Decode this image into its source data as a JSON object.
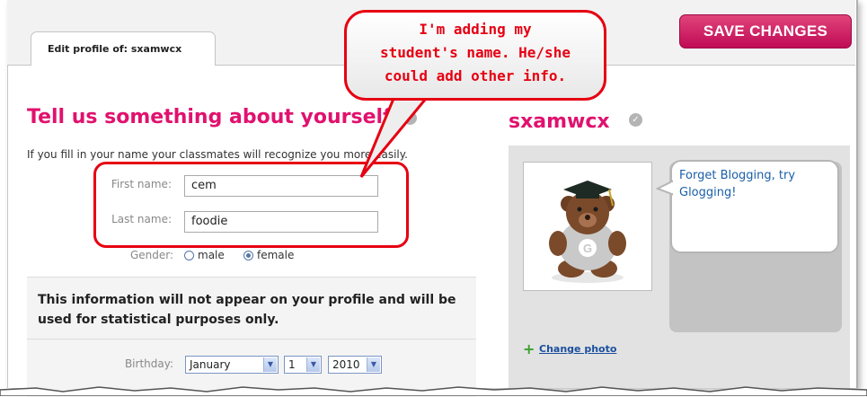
{
  "tab": {
    "label": "Edit profile of: sxamwcx"
  },
  "toolbar": {
    "save_label": "SAVE CHANGES"
  },
  "form": {
    "heading": "Tell us something about yourself",
    "subtitle": "If you fill in your name your classmates will recognize you more easily.",
    "first_name_label": "First name:",
    "first_name_value": "cem",
    "last_name_label": "Last name:",
    "last_name_value": "foodie",
    "gender_label": "Gender:",
    "gender_options": [
      "male",
      "female"
    ],
    "gender_selected": "female"
  },
  "info": {
    "notice": "This information will not appear on your profile and will be used for statistical purposes only.",
    "birthday_label": "Birthday:",
    "birthday_month": "January",
    "birthday_day": "1",
    "birthday_year": "2010"
  },
  "profile": {
    "username": "sxamwcx",
    "status_text": "Forget Blogging, try Glogging!",
    "change_photo_label": "Change photo"
  },
  "annotation": {
    "callout_lines": [
      "I'm adding my",
      "student's name. He/she",
      "could add other info."
    ]
  },
  "colors": {
    "accent": "#e0126e",
    "callout": "#e60012",
    "link": "#1a4f9e"
  },
  "icons": [
    "verified-check-icon",
    "plus-icon",
    "dropdown-arrow-icon",
    "radio-icon"
  ]
}
